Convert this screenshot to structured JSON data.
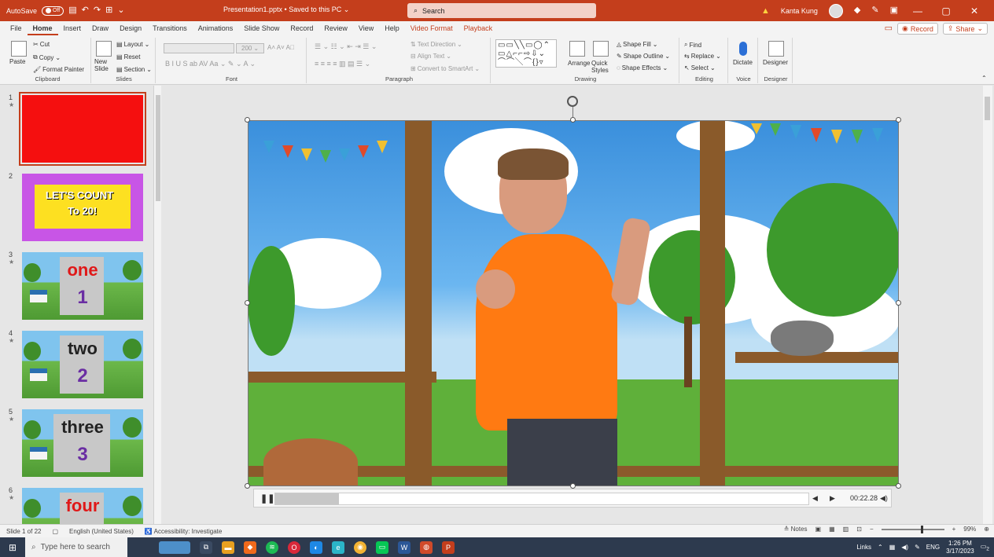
{
  "titlebar": {
    "autosave_label": "AutoSave",
    "autosave_state": "Off",
    "doc_title": "Presentation1.pptx • Saved to this PC",
    "search_placeholder": "Search",
    "user_name": "Kanta Kung"
  },
  "menu": {
    "tabs": [
      "File",
      "Home",
      "Insert",
      "Draw",
      "Design",
      "Transitions",
      "Animations",
      "Slide Show",
      "Record",
      "Review",
      "View",
      "Help",
      "Video Format",
      "Playback"
    ],
    "active": "Home",
    "record_label": "Record",
    "share_label": "Share"
  },
  "ribbon": {
    "clipboard": {
      "paste": "Paste",
      "cut": "Cut",
      "copy": "Copy",
      "format_painter": "Format Painter",
      "label": "Clipboard"
    },
    "slides": {
      "new_slide": "New Slide",
      "layout": "Layout",
      "reset": "Reset",
      "section": "Section",
      "label": "Slides"
    },
    "font": {
      "size": "200",
      "label": "Font"
    },
    "paragraph": {
      "text_direction": "Text Direction",
      "align_text": "Align Text",
      "convert_smartart": "Convert to SmartArt",
      "label": "Paragraph"
    },
    "drawing": {
      "arrange": "Arrange",
      "quick_styles": "Quick Styles",
      "shape_fill": "Shape Fill",
      "shape_outline": "Shape Outline",
      "shape_effects": "Shape Effects",
      "label": "Drawing"
    },
    "editing": {
      "find": "Find",
      "replace": "Replace",
      "select": "Select",
      "label": "Editing"
    },
    "voice": {
      "dictate": "Dictate",
      "label": "Voice"
    },
    "designer": {
      "button": "Designer",
      "label": "Designer"
    }
  },
  "slides": [
    {
      "num": "1",
      "kind": "red"
    },
    {
      "num": "2",
      "kind": "count",
      "line1": "LET'S COUNT",
      "line2": "To 20!"
    },
    {
      "num": "3",
      "kind": "number",
      "word": "one",
      "digit": "1"
    },
    {
      "num": "4",
      "kind": "number",
      "word": "two",
      "digit": "2"
    },
    {
      "num": "5",
      "kind": "number",
      "word": "three",
      "digit": "3"
    },
    {
      "num": "6",
      "kind": "number",
      "word": "four",
      "digit": ""
    }
  ],
  "playback": {
    "time": "00:22.28",
    "progress_fraction": 0.12
  },
  "status": {
    "slide_info": "Slide 1 of 22",
    "language": "English (United States)",
    "accessibility": "Accessibility: Investigate",
    "notes": "Notes",
    "zoom": "99%"
  },
  "taskbar": {
    "search_placeholder": "Type here to search",
    "links": "Links",
    "lang": "ENG",
    "time": "1:26 PM",
    "date": "3/17/2023",
    "notif_count": "2"
  },
  "colors": {
    "accent": "#c43e1c",
    "slide1_fill": "#f50f0f"
  }
}
